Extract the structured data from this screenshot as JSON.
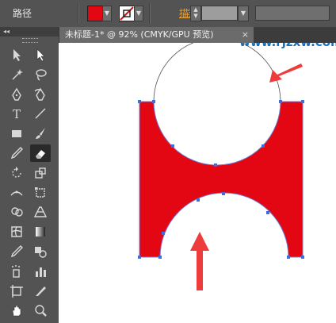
{
  "control_bar": {
    "selection_type": "路径",
    "fill_color": "#e30613",
    "stroke_label": "描边",
    "stroke_colon": ":"
  },
  "document_tab": {
    "title": "未标题-1* @ 92% (CMYK/GPU 预览)",
    "close_symbol": "×"
  },
  "tools_panel": {
    "collapse_symbol": "◂◂"
  },
  "watermark": "www.rjzxw.com",
  "colors": {
    "shape_fill": "#e30613",
    "anchor": "#3b6fe0",
    "path_line": "#6b7fd6",
    "arrow": "#ee3b3b"
  },
  "tools": [
    {
      "name": "selection-tool",
      "icon": "arrow-icon"
    },
    {
      "name": "direct-selection-tool",
      "icon": "white-arrow-icon"
    },
    {
      "name": "magic-wand-tool",
      "icon": "wand-icon"
    },
    {
      "name": "lasso-tool",
      "icon": "lasso-icon"
    },
    {
      "name": "pen-tool",
      "icon": "pen-icon"
    },
    {
      "name": "curvature-tool",
      "icon": "curvature-pen-icon"
    },
    {
      "name": "type-tool",
      "icon": "type-icon"
    },
    {
      "name": "line-segment-tool",
      "icon": "line-icon"
    },
    {
      "name": "rectangle-tool",
      "icon": "rectangle-icon"
    },
    {
      "name": "paintbrush-tool",
      "icon": "brush-icon"
    },
    {
      "name": "pencil-tool",
      "icon": "pencil-icon"
    },
    {
      "name": "eraser-tool",
      "icon": "eraser-icon",
      "active": true
    },
    {
      "name": "rotate-tool",
      "icon": "rotate-icon"
    },
    {
      "name": "scale-tool",
      "icon": "scale-icon"
    },
    {
      "name": "width-tool",
      "icon": "width-icon"
    },
    {
      "name": "free-transform-tool",
      "icon": "free-transform-icon"
    },
    {
      "name": "shape-builder-tool",
      "icon": "shape-builder-icon"
    },
    {
      "name": "perspective-grid-tool",
      "icon": "perspective-icon"
    },
    {
      "name": "mesh-tool",
      "icon": "mesh-icon"
    },
    {
      "name": "gradient-tool",
      "icon": "gradient-icon"
    },
    {
      "name": "eyedropper-tool",
      "icon": "eyedropper-icon"
    },
    {
      "name": "blend-tool",
      "icon": "blend-icon"
    },
    {
      "name": "symbol-sprayer-tool",
      "icon": "sprayer-icon"
    },
    {
      "name": "column-graph-tool",
      "icon": "graph-icon"
    },
    {
      "name": "artboard-tool",
      "icon": "artboard-icon"
    },
    {
      "name": "slice-tool",
      "icon": "slice-icon"
    },
    {
      "name": "hand-tool",
      "icon": "hand-icon"
    },
    {
      "name": "zoom-tool",
      "icon": "zoom-icon"
    }
  ]
}
